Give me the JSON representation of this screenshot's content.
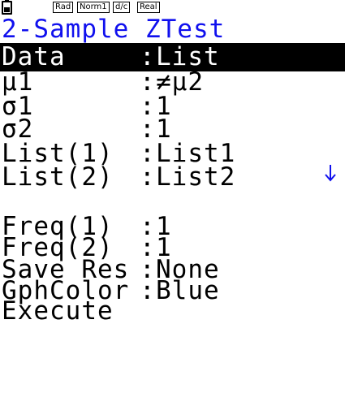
{
  "status_bar": {
    "angle_mode": "Rad",
    "display_mode": "Norm1",
    "fraction_mode": "d/c",
    "complex_mode": "Real",
    "battery_icon": "battery-icon"
  },
  "title": "2-Sample ZTest",
  "separator": ":",
  "rows_top": [
    {
      "label": "Data",
      "value": "List",
      "selected": true
    },
    {
      "label": "μ1",
      "value": "≠μ2"
    },
    {
      "label": "σ1",
      "value": "1"
    },
    {
      "label": "σ2",
      "value": "1"
    },
    {
      "label": "List(1)",
      "value": "List1"
    },
    {
      "label": "List(2)",
      "value": "List2"
    }
  ],
  "rows_bottom": [
    {
      "label": "Freq(1)",
      "value": "1"
    },
    {
      "label": "Freq(2)",
      "value": "1"
    },
    {
      "label": "Save Res",
      "value": "None"
    },
    {
      "label": "GphColor",
      "value": "Blue"
    },
    {
      "label": "Execute",
      "value": ""
    }
  ],
  "scroll_indicator": "arrow-down-icon",
  "colors": {
    "title": "#1010ee",
    "scroll_arrow": "#1010ee",
    "highlight_bg": "#000000",
    "highlight_fg": "#ffffff"
  }
}
